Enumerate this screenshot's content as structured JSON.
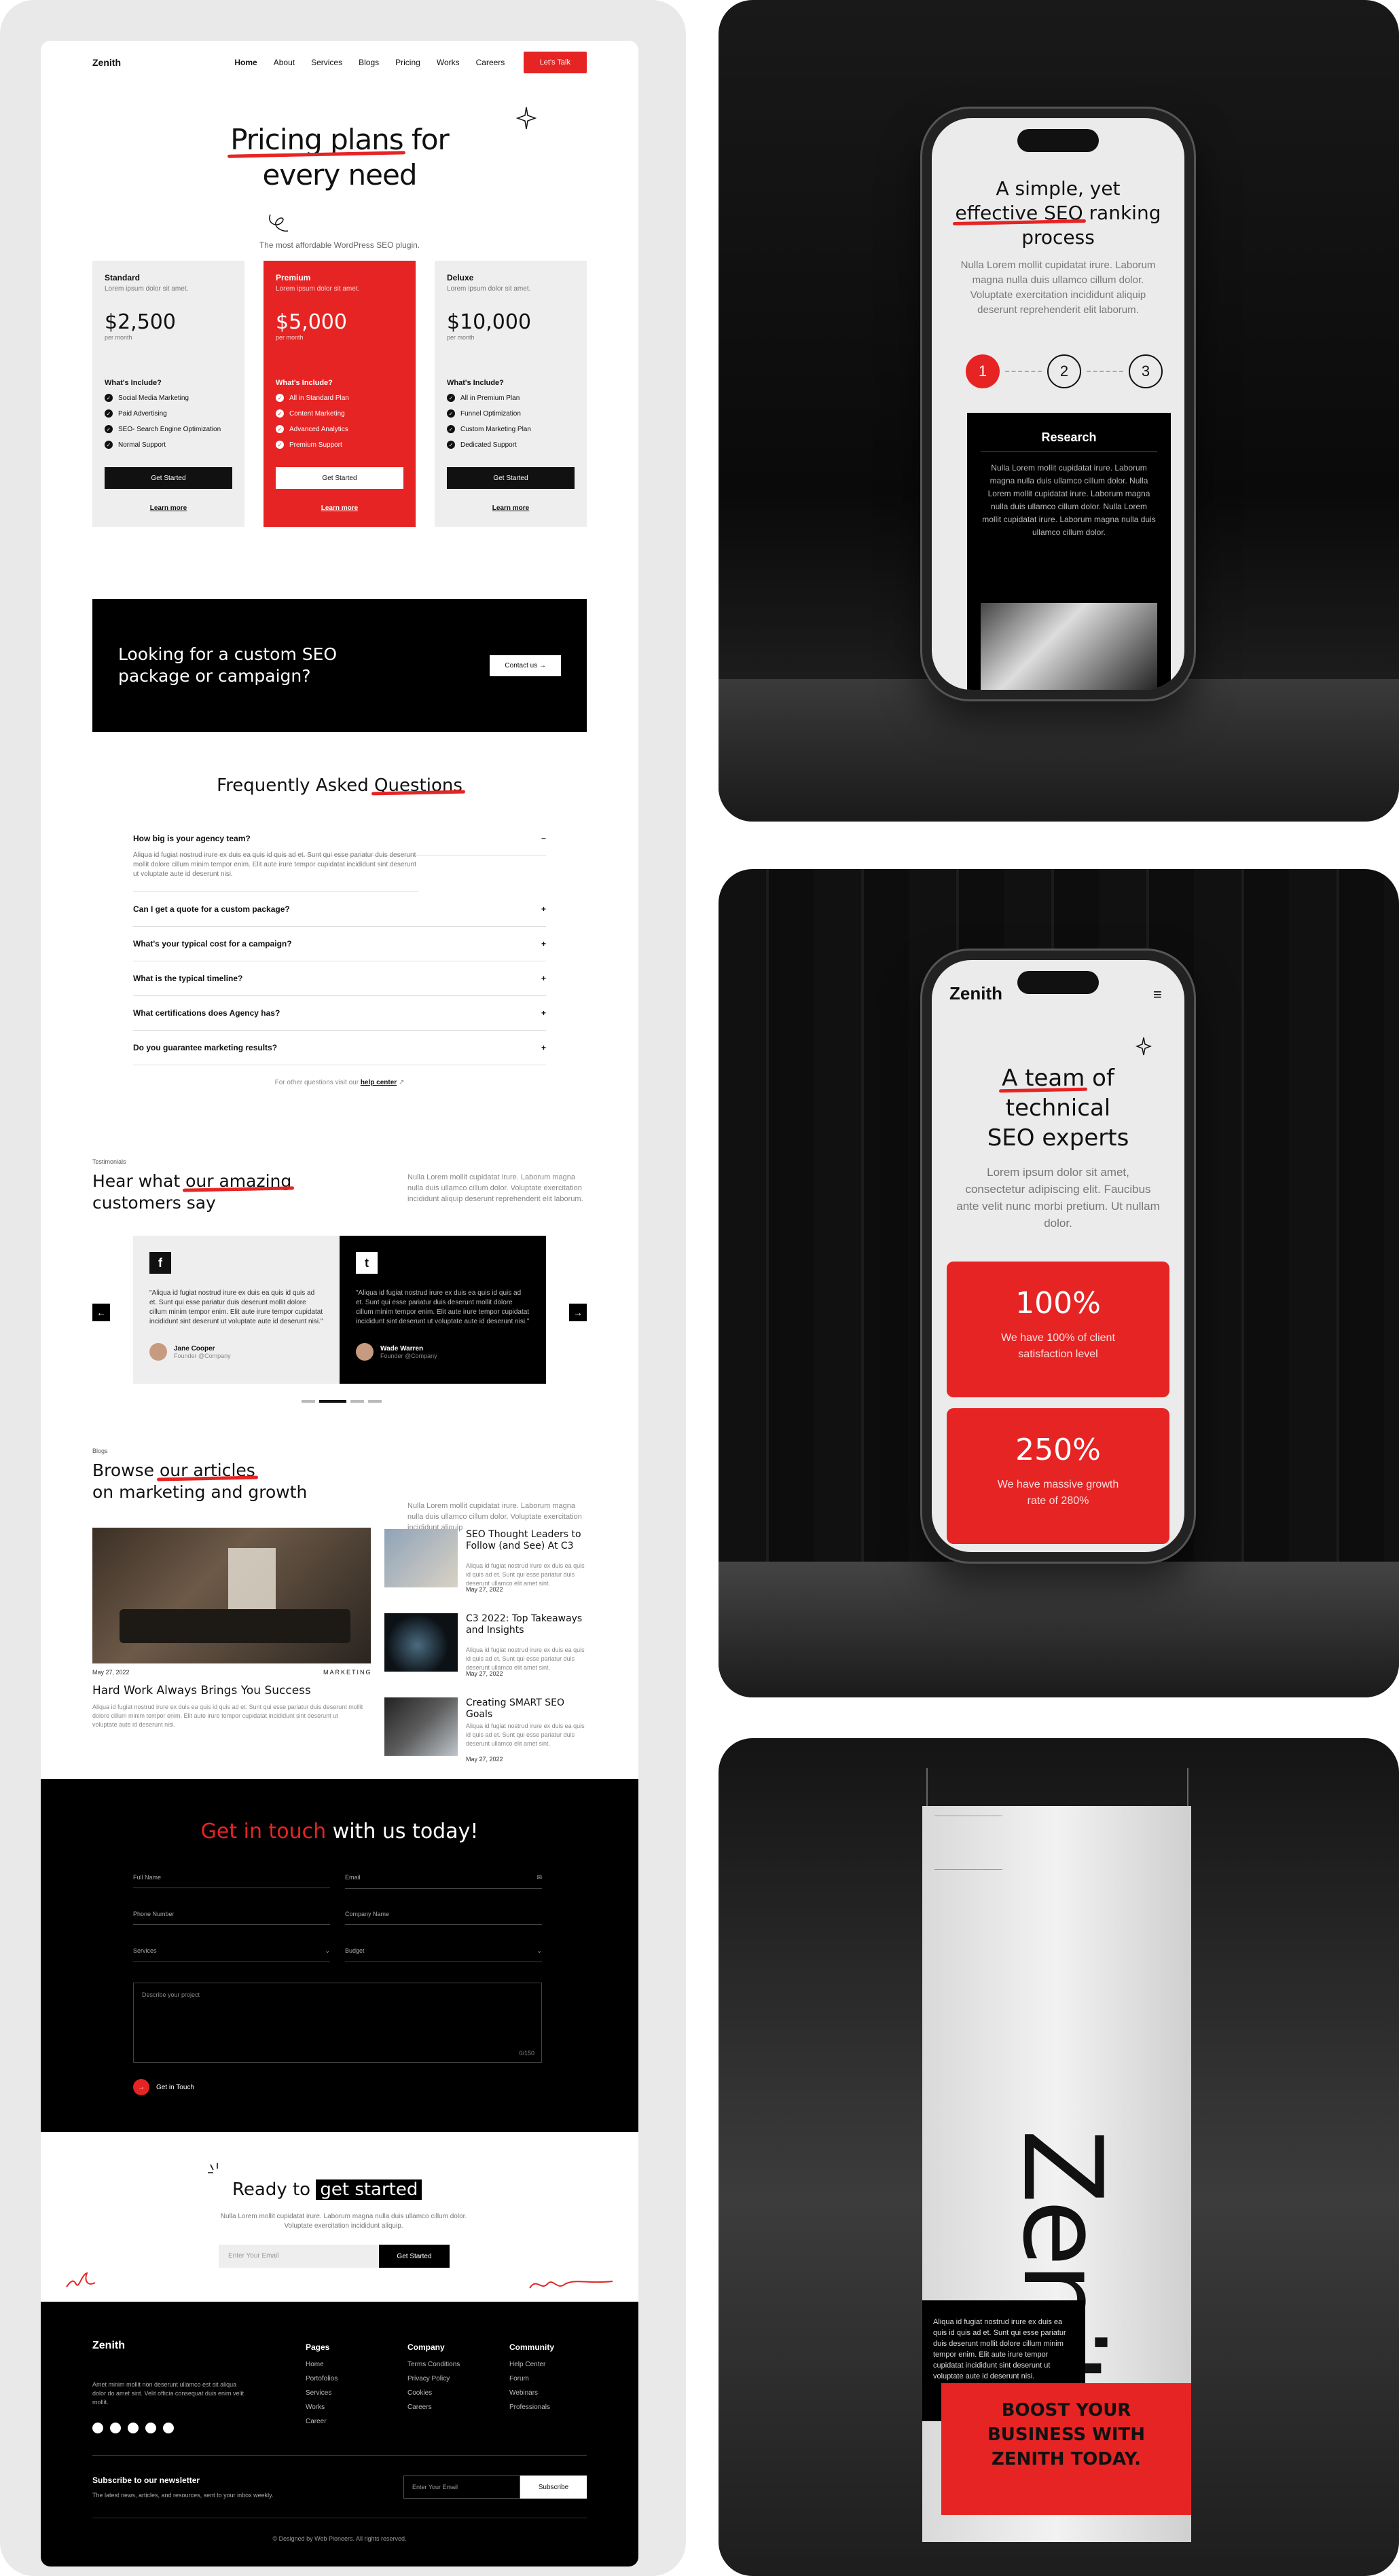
{
  "nav": {
    "logo": "Zenith",
    "links": [
      "Home",
      "About",
      "Services",
      "Blogs",
      "Pricing",
      "Works",
      "Careers"
    ],
    "cta": "Let's Talk"
  },
  "pricing": {
    "title_pre": "Pricing plans",
    "title_post": "for",
    "title_line2": "every need",
    "subtitle": "The most affordable WordPress SEO plugin.",
    "plans": [
      {
        "name": "Standard",
        "desc": "Lorem ipsum dolor sit amet.",
        "price": "$2,500",
        "period": "per month",
        "include_label": "What's Include?",
        "features": [
          "Social Media Marketing",
          "Paid Advertising",
          "SEO- Search Engine Optimization",
          "Normal Support"
        ],
        "cta": "Get Started",
        "link": "Learn more"
      },
      {
        "name": "Premium",
        "desc": "Lorem ipsum dolor sit amet.",
        "price": "$5,000",
        "period": "per month",
        "include_label": "What's Include?",
        "features": [
          "All in Standard Plan",
          "Content Marketing",
          "Advanced Analytics",
          "Premium Support"
        ],
        "cta": "Get Started",
        "link": "Learn more"
      },
      {
        "name": "Deluxe",
        "desc": "Lorem ipsum dolor sit amet.",
        "price": "$10,000",
        "period": "per month",
        "include_label": "What's Include?",
        "features": [
          "All in Premium Plan",
          "Funnel Optimization",
          "Custom Marketing Plan",
          "Dedicated Support"
        ],
        "cta": "Get Started",
        "link": "Learn more"
      }
    ]
  },
  "custom": {
    "line1": "Looking for a custom SEO",
    "line2": "package or campaign?",
    "cta": "Contact us"
  },
  "faq": {
    "title_pre": "Frequently Asked",
    "title_hl": "Questions",
    "items": [
      {
        "q": "How big is your agency team?",
        "a": "Aliqua id fugiat nostrud irure ex duis ea quis id quis ad et. Sunt qui esse pariatur duis deserunt mollit dolore cillum minim tempor enim. Elit aute irure tempor cupidatat incididunt sint deserunt ut voluptate aute id deserunt nisi.",
        "open": true
      },
      {
        "q": "Can I get a quote for a custom package?"
      },
      {
        "q": "What's your typical cost for a campaign?"
      },
      {
        "q": "What is the typical timeline?"
      },
      {
        "q": "What certifications does Agency has?"
      },
      {
        "q": "Do you guarantee marketing results?"
      }
    ],
    "other_pre": "For other questions visit our",
    "other_link": "help center"
  },
  "testimonials": {
    "tag": "Testimonials",
    "title_pre": "Hear what",
    "title_hl": "our amazing",
    "title_line2": "customers say",
    "desc": "Nulla Lorem mollit cupidatat irure. Laborum magna nulla duis ullamco cillum dolor. Voluptate exercitation incididunt aliquip deserunt reprehenderit elit laborum.",
    "items": [
      {
        "icon": "f",
        "quote": "\"Aliqua id fugiat nostrud irure ex duis ea quis id quis ad et. Sunt qui esse pariatur duis deserunt mollit dolore cillum minim tempor enim. Elit aute irure tempor cupidatat incididunt sint deserunt ut voluptate aute id deserunt nisi.\"",
        "name": "Jane Cooper",
        "role": "Founder @Company"
      },
      {
        "icon": "t",
        "quote": "\"Aliqua id fugiat nostrud irure ex duis ea quis id quis ad et. Sunt qui esse pariatur duis deserunt mollit dolore cillum minim tempor enim. Elit aute irure tempor cupidatat incididunt sint deserunt ut voluptate aute id deserunt nisi.\"",
        "name": "Wade Warren",
        "role": "Founder @Company"
      }
    ]
  },
  "blogs": {
    "tag": "Blogs",
    "title_pre": "Browse",
    "title_hl": "our articles",
    "title_line2": "on marketing and growth",
    "desc": "Nulla Lorem mollit cupidatat irure. Laborum magna nulla duis ullamco cillum dolor. Voluptate exercitation incididunt aliquip",
    "main": {
      "date": "May 27, 2022",
      "category": "MARKETING",
      "title": "Hard Work Always Brings You Success",
      "desc": "Aliqua id fugiat nostrud irure ex duis ea quis id quis ad et. Sunt qui esse pariatur duis deserunt mollit dolore cillum minim tempor enim. Elit aute irure tempor cupidatat incididunt sint deserunt ut voluptate aute id deserunt nisi."
    },
    "side": [
      {
        "title": "SEO Thought Leaders to Follow (and See) At C3",
        "desc": "Aliqua id fugiat nostrud irure ex duis ea quis id quis ad et. Sunt qui esse pariatur duis deserunt ullamco elit amet sint.",
        "date": "May 27, 2022"
      },
      {
        "title": "C3 2022: Top Takeaways and Insights",
        "desc": "Aliqua id fugiat nostrud irure ex duis ea quis id quis ad et. Sunt qui esse pariatur duis deserunt ullamco elit amet sint.",
        "date": "May 27, 2022"
      },
      {
        "title": "Creating SMART SEO Goals",
        "desc": "Aliqua id fugiat nostrud irure ex duis ea quis id quis ad et. Sunt qui esse pariatur duis deserunt ullamco elit amet sint.",
        "date": "May 27, 2022"
      }
    ]
  },
  "contact": {
    "title_hl": "Get in touch",
    "title_post": "with us today!",
    "fields": [
      "Full Name",
      "Email",
      "Phone Number",
      "Company Name",
      "Services",
      "Budget"
    ],
    "message_placeholder": "Describe your project",
    "counter": "0/150",
    "cta": "Get in Touch"
  },
  "ready": {
    "pre": "Ready to",
    "hl": "get started",
    "desc": "Nulla Lorem mollit cupidatat irure. Laborum magna nulla duis ullamco cillum dolor. Voluptate exercitation incididunt aliquip.",
    "placeholder": "Enter Your Email",
    "cta": "Get Started"
  },
  "footer": {
    "logo": "Zenith",
    "about": "Amet minim mollit non deserunt ullamco est sit aliqua dolor do amet sint. Velit officia consequat duis enim velit mollit.",
    "cols": [
      {
        "title": "Pages",
        "items": [
          "Home",
          "Portofolios",
          "Services",
          "Works",
          "Career"
        ]
      },
      {
        "title": "Company",
        "items": [
          "Terms Conditions",
          "Privacy Policy",
          "Cookies",
          "Careers"
        ]
      },
      {
        "title": "Community",
        "items": [
          "Help Center",
          "Forum",
          "Webinars",
          "Professionals"
        ]
      }
    ],
    "newsletter_title": "Subscribe to our newsletter",
    "newsletter_desc": "The latest news, articles, and resources, sent to your inbox weekly.",
    "newsletter_placeholder": "Enter Your Email",
    "newsletter_cta": "Subscribe",
    "copyright": "© Designed by Web Pioneers. All rights reserved."
  },
  "phone1": {
    "title_l1": "A simple, yet",
    "title_hl": "effective SEO",
    "title_l2b": "ranking",
    "title_l3": "process",
    "desc": "Nulla Lorem mollit cupidatat irure. Laborum magna nulla duis ullamco cillum dolor. Voluptate exercitation incididunt aliquip deserunt reprehenderit elit laborum.",
    "steps": [
      "1",
      "2",
      "3"
    ],
    "card_title": "Research",
    "card_desc": "Nulla Lorem mollit cupidatat irure. Laborum magna nulla duis ullamco cillum dolor. Nulla Lorem mollit cupidatat irure. Laborum magna nulla duis ullamco cillum dolor. Nulla Lorem mollit cupidatat irure. Laborum magna nulla duis ullamco cillum dolor."
  },
  "phone2": {
    "logo": "Zenith",
    "title_hl": "A team",
    "title_l1b": "of",
    "title_l2": "technical",
    "title_l3": "SEO experts",
    "desc": "Lorem ipsum dolor sit amet, consectetur adipiscing elit. Faucibus ante velit nunc morbi pretium. Ut nullam dolor.",
    "stats": [
      {
        "value": "100%",
        "label": "We have 100% of client satisfaction level"
      },
      {
        "value": "250%",
        "label": "We have massive growth rate of 280%"
      }
    ]
  },
  "banner": {
    "brand": "Zenith",
    "para": "Aliqua id fugiat nostrud irure ex duis ea quis id quis ad et. Sunt qui esse pariatur duis deserunt mollit dolore cillum minim tempor enim. Elit aute irure tempor cupidatat incididunt sint deserunt ut voluptate aute id deserunt nisi.",
    "headline": "BOOST YOUR BUSINESS WITH ZENITH TODAY."
  }
}
